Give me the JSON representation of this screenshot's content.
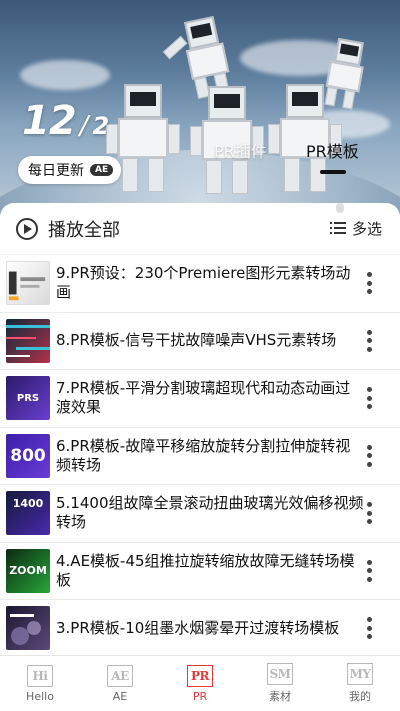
{
  "hero": {
    "counter_current": "12",
    "counter_separator": "/",
    "counter_total": "2",
    "update_label": "每日更新",
    "update_tag": "AE",
    "tabs": [
      {
        "label": "PR插件",
        "active": false
      },
      {
        "label": "PR模板",
        "active": true
      }
    ]
  },
  "toolbar": {
    "play_all_label": "播放全部",
    "multi_select_label": "多选"
  },
  "items": [
    {
      "title": "9.PR预设：230个Premiere图形元素转场动画",
      "thumb_text": "",
      "thumb_colors": [
        "#ffffff",
        "#d9d9d9"
      ],
      "thumb_icon": "motion-elements-thumb-icon"
    },
    {
      "title": "8.PR模板-信号干扰故障噪声VHS元素转场",
      "thumb_text": "",
      "thumb_colors": [
        "#0e2a3a",
        "#b2324a"
      ],
      "thumb_icon": "glitch-vhs-thumb-icon"
    },
    {
      "title": "7.PR模板-平滑分割玻璃超现代和动态动画过渡效果",
      "thumb_text": "PRS",
      "thumb_colors": [
        "#2b1a6a",
        "#6a3fd0"
      ],
      "thumb_icon": "glass-split-thumb-icon"
    },
    {
      "title": "6.PR模板-故障平移缩放旋转分割拉伸旋转视频转场",
      "thumb_text": "800",
      "thumb_colors": [
        "#3a1fa8",
        "#6c3bd6"
      ],
      "thumb_icon": "transitions-800-thumb-icon"
    },
    {
      "title": "5.1400组故障全景滚动扭曲玻璃光效偏移视频转场",
      "thumb_text": "1400",
      "thumb_colors": [
        "#141a3a",
        "#4a2ab0"
      ],
      "thumb_icon": "transitions-1400-thumb-icon"
    },
    {
      "title": "4.AE模板-45组推拉旋转缩放故障无缝转场模板",
      "thumb_text": "ZOOM",
      "thumb_colors": [
        "#0d2a12",
        "#27a63a"
      ],
      "thumb_icon": "zoom-transitions-thumb-icon"
    },
    {
      "title": "3.PR模板-10组墨水烟雾晕开过渡转场模板",
      "thumb_text": "",
      "thumb_colors": [
        "#1b1730",
        "#5a4a7a"
      ],
      "thumb_icon": "ink-smoke-thumb-icon"
    }
  ],
  "bottom_nav": [
    {
      "icon_text": "Hi",
      "label": "Hello",
      "active": false
    },
    {
      "icon_text": "AE",
      "label": "AE",
      "active": false
    },
    {
      "icon_text": "PR",
      "label": "PR",
      "active": true
    },
    {
      "icon_text": "SM",
      "label": "素材",
      "active": false
    },
    {
      "icon_text": "MY",
      "label": "我的",
      "active": false
    }
  ],
  "colors": {
    "accent": "#e53935",
    "nav_inactive": "#b8b8b8"
  }
}
